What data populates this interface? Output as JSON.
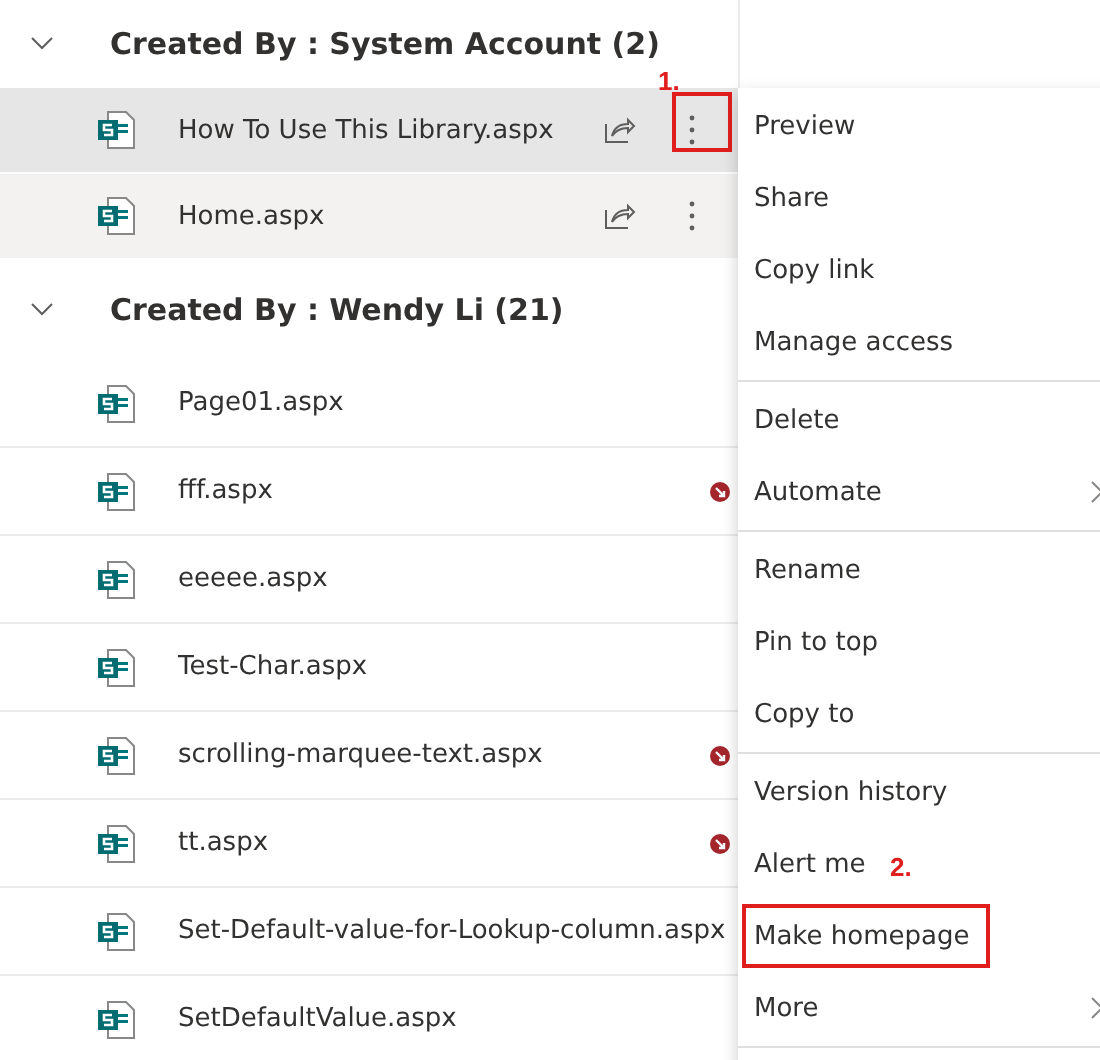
{
  "groups": [
    {
      "title": "Created By : System Account (2)",
      "expanded": true,
      "files": [
        {
          "name": "How To Use This Library.aspx",
          "selected": true,
          "hovered": false,
          "actions_visible": true,
          "checked_out": false,
          "annotation": "1."
        },
        {
          "name": "Home.aspx",
          "selected": false,
          "hovered": true,
          "actions_visible": true,
          "checked_out": false
        }
      ]
    },
    {
      "title": "Created By : Wendy Li (21)",
      "expanded": true,
      "files": [
        {
          "name": "Page01.aspx",
          "selected": false,
          "hovered": false,
          "actions_visible": false,
          "checked_out": false
        },
        {
          "name": "fff.aspx",
          "selected": false,
          "hovered": false,
          "actions_visible": false,
          "checked_out": true
        },
        {
          "name": "eeeee.aspx",
          "selected": false,
          "hovered": false,
          "actions_visible": false,
          "checked_out": false
        },
        {
          "name": "Test-Char.aspx",
          "selected": false,
          "hovered": false,
          "actions_visible": false,
          "checked_out": false
        },
        {
          "name": "scrolling-marquee-text.aspx",
          "selected": false,
          "hovered": false,
          "actions_visible": false,
          "checked_out": true
        },
        {
          "name": "tt.aspx",
          "selected": false,
          "hovered": false,
          "actions_visible": false,
          "checked_out": true
        },
        {
          "name": "Set-Default-value-for-Lookup-column.aspx",
          "selected": false,
          "hovered": false,
          "actions_visible": false,
          "checked_out": false
        },
        {
          "name": "SetDefaultValue.aspx",
          "selected": false,
          "hovered": false,
          "actions_visible": false,
          "checked_out": false
        }
      ]
    }
  ],
  "context_menu": {
    "sections": [
      {
        "items": [
          {
            "label": "Preview",
            "submenu": false
          },
          {
            "label": "Share",
            "submenu": false
          },
          {
            "label": "Copy link",
            "submenu": false
          },
          {
            "label": "Manage access",
            "submenu": false
          }
        ]
      },
      {
        "items": [
          {
            "label": "Delete",
            "submenu": false
          },
          {
            "label": "Automate",
            "submenu": true
          }
        ]
      },
      {
        "items": [
          {
            "label": "Rename",
            "submenu": false
          },
          {
            "label": "Pin to top",
            "submenu": false
          },
          {
            "label": "Copy to",
            "submenu": false
          }
        ]
      },
      {
        "items": [
          {
            "label": "Version history",
            "submenu": false
          },
          {
            "label": "Alert me",
            "submenu": false
          },
          {
            "label": "Make homepage",
            "submenu": false,
            "annotation": "2."
          },
          {
            "label": "More",
            "submenu": true
          }
        ]
      }
    ]
  }
}
